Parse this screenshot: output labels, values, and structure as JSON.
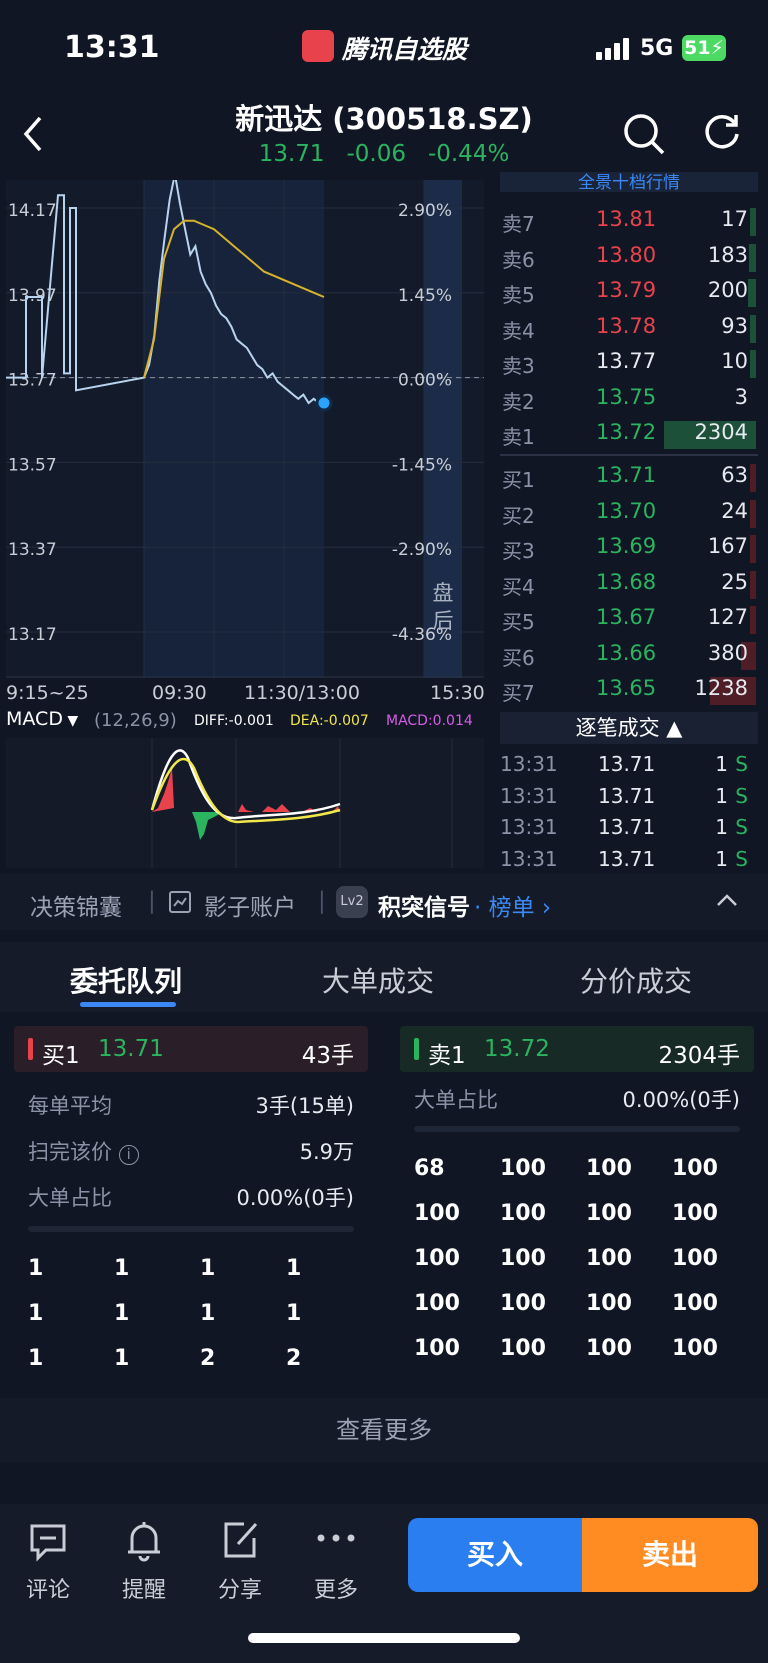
{
  "status_bar": {
    "time": "13:31",
    "app_name": "腾讯自选股",
    "network": "5G",
    "battery": "51"
  },
  "header": {
    "title": "新迅达 (300518.SZ)",
    "price": "13.71",
    "change": "-0.06",
    "change_pct": "-0.44%"
  },
  "chart_data": {
    "type": "line",
    "y_price_ticks": [
      "14.17",
      "13.97",
      "13.77",
      "13.57",
      "13.37",
      "13.17"
    ],
    "y_pct_ticks": [
      "2.90%",
      "1.45%",
      "0.00%",
      "-1.45%",
      "-2.90%",
      "-4.36%"
    ],
    "x_ticks": [
      "9:15~25",
      "09:30",
      "11:30/13:00",
      "15:30"
    ],
    "after_hours_label": [
      "盘",
      "后"
    ],
    "ylim": [
      13.17,
      14.17
    ],
    "prev_close": 13.77,
    "series": [
      {
        "values": [
          13.77,
          13.8,
          13.87,
          14.0,
          14.1,
          14.19,
          14.25,
          14.18,
          14.12,
          14.06,
          14.08,
          14.02,
          13.99,
          13.97,
          13.94,
          13.92,
          13.91,
          13.89,
          13.86,
          13.85,
          13.84,
          13.82,
          13.8,
          13.79,
          13.77,
          13.78,
          13.76,
          13.75,
          13.74,
          13.73,
          13.72,
          13.73,
          13.71,
          13.72,
          13.71,
          13.71
        ]
      },
      {
        "values": [
          13.77,
          13.86,
          14.05,
          14.12,
          14.14,
          14.14,
          14.13,
          14.12,
          14.1,
          14.08,
          14.06,
          14.04,
          14.02,
          14.01,
          14.0,
          13.99,
          13.98,
          13.97,
          13.96
        ]
      }
    ]
  },
  "macd": {
    "label": "MACD",
    "params": "(12,26,9)",
    "diff": "DIFF:-0.001",
    "dea": "DEA:-0.007",
    "macd": "MACD:0.014"
  },
  "order_book": {
    "asks": [
      {
        "label": "卖7",
        "price": "13.81",
        "vol": "17",
        "bar": 0.01
      },
      {
        "label": "卖6",
        "price": "13.80",
        "vol": "183",
        "bar": 0.08
      },
      {
        "label": "卖5",
        "price": "13.79",
        "vol": "200",
        "bar": 0.09
      },
      {
        "label": "卖4",
        "price": "13.78",
        "vol": "93",
        "bar": 0.04
      },
      {
        "label": "卖3",
        "price": "13.77",
        "vol": "10",
        "bar": 0.01
      },
      {
        "label": "卖2",
        "price": "13.75",
        "vol": "3",
        "bar": 0.0
      },
      {
        "label": "卖1",
        "price": "13.72",
        "vol": "2304",
        "bar": 1.0
      }
    ],
    "bids": [
      {
        "label": "买1",
        "price": "13.71",
        "vol": "63",
        "bar": 0.03
      },
      {
        "label": "买2",
        "price": "13.70",
        "vol": "24",
        "bar": 0.01
      },
      {
        "label": "买3",
        "price": "13.69",
        "vol": "167",
        "bar": 0.07
      },
      {
        "label": "买4",
        "price": "13.68",
        "vol": "25",
        "bar": 0.01
      },
      {
        "label": "买5",
        "price": "13.67",
        "vol": "127",
        "bar": 0.05
      },
      {
        "label": "买6",
        "price": "13.66",
        "vol": "380",
        "bar": 0.16
      },
      {
        "label": "买7",
        "price": "13.65",
        "vol": "1238",
        "bar": 0.5
      }
    ],
    "top_label": "全景十档行情",
    "ticks_header": "逐笔成交",
    "ticks": [
      {
        "time": "13:31",
        "price": "13.71",
        "vol": "1",
        "side": "S"
      },
      {
        "time": "13:31",
        "price": "13.71",
        "vol": "1",
        "side": "S"
      },
      {
        "time": "13:31",
        "price": "13.71",
        "vol": "1",
        "side": "S"
      },
      {
        "time": "13:31",
        "price": "13.71",
        "vol": "1",
        "side": "S"
      }
    ]
  },
  "tools": {
    "t1": "决策锦囊",
    "t2": "影子账户",
    "t3": "积突信号",
    "t3_link": "· 榜单",
    "badge": "Lv2"
  },
  "tabs": [
    "委托队列",
    "大单成交",
    "分价成交"
  ],
  "buy_queue": {
    "side": "买1",
    "price": "13.71",
    "vol": "43手",
    "stats": [
      {
        "k": "每单平均",
        "v": "3手(15单)"
      },
      {
        "k": "扫完该价",
        "v": "5.9万"
      },
      {
        "k": "大单占比",
        "v": "0.00%(0手)"
      }
    ],
    "grid": [
      "1",
      "1",
      "1",
      "1",
      "1",
      "1",
      "1",
      "1",
      "1",
      "1",
      "2",
      "2"
    ]
  },
  "sell_queue": {
    "side": "卖1",
    "price": "13.72",
    "vol": "2304手",
    "stats": [
      {
        "k": "大单占比",
        "v": "0.00%(0手)"
      }
    ],
    "grid": [
      "68",
      "100",
      "100",
      "100",
      "100",
      "100",
      "100",
      "100",
      "100",
      "100",
      "100",
      "100",
      "100",
      "100",
      "100",
      "100",
      "100",
      "100",
      "100",
      "100"
    ]
  },
  "more_label": "查看更多",
  "bottom": {
    "comment": "评论",
    "remind": "提醒",
    "share": "分享",
    "more": "更多",
    "buy": "买入",
    "sell": "卖出"
  }
}
